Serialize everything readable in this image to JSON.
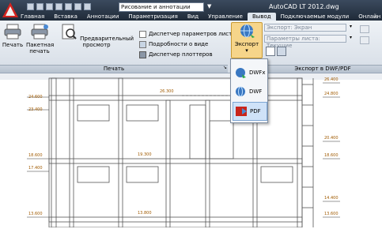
{
  "title_bar": {
    "workspace": "Рисование и аннотации",
    "window_title": "AutoCAD LT 2012.dwg"
  },
  "tabs": [
    "Главная",
    "Вставка",
    "Аннотации",
    "Параметризация",
    "Вид",
    "Управление",
    "Вывод",
    "Подключаемые модули",
    "Онлайн"
  ],
  "active_tab": "Вывод",
  "ribbon": {
    "print_panel": {
      "title": "Печать",
      "print_label": "Печать",
      "batch_label_1": "Пакетная",
      "batch_label_2": "печать",
      "preview_label": "Предварительный просмотр",
      "page_setup": "Диспетчер параметров листов",
      "details": "Подробности о виде",
      "plotter_mgr": "Диспетчер плоттеров"
    },
    "export": {
      "button_label": "Экспорт",
      "export_field": "Экспорт: Экран",
      "params_field": "Параметры листа: Текущие",
      "panel_title": "Экспорт в DWF/PDF"
    }
  },
  "export_menu": [
    {
      "label": "DWFx",
      "icon": "dwfx-icon"
    },
    {
      "label": "DWF",
      "icon": "dwf-icon"
    },
    {
      "label": "PDF",
      "icon": "pdf-icon"
    }
  ],
  "drawing": {
    "left_labels": [
      "24.600",
      "23.400",
      "18.600",
      "17.400",
      "13.600"
    ],
    "right_labels": [
      "26.400",
      "24.800",
      "20.400",
      "18.600",
      "14.400",
      "13.600"
    ],
    "mid_labels": [
      "26.300",
      "19.300",
      "13.800"
    ]
  },
  "colors": {
    "title_bg": "#1f2a38",
    "ribbon_bg": "#dfe6ee",
    "accent": "#3a78c2",
    "pdf_red": "#c8241b"
  }
}
